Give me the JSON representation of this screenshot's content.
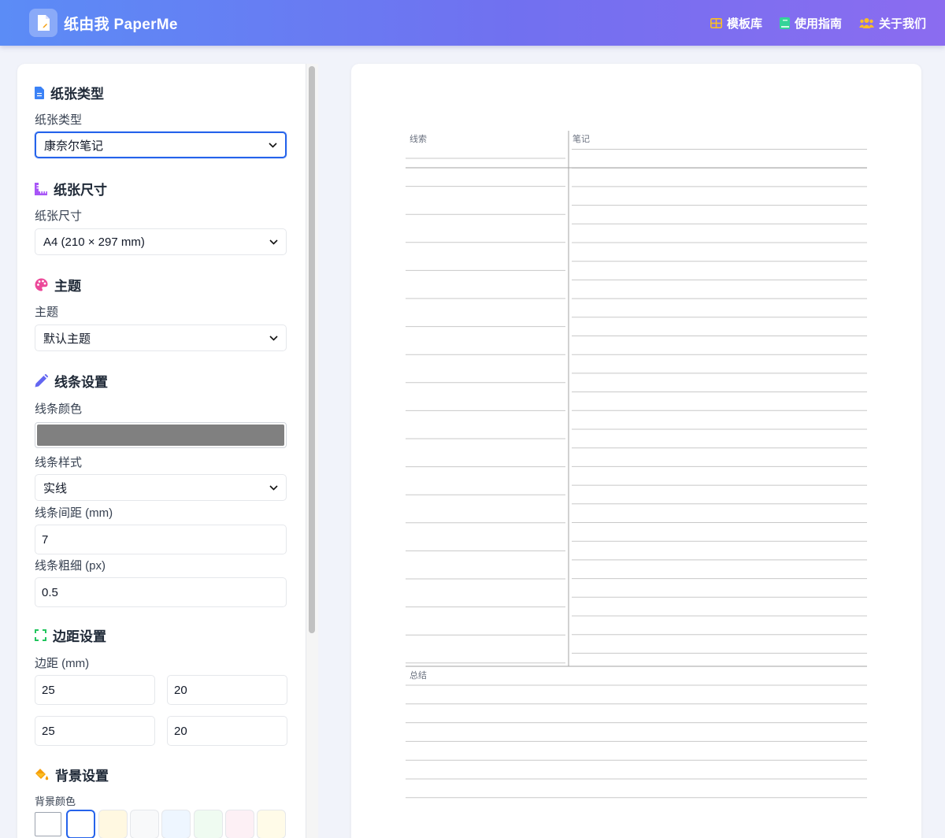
{
  "app": {
    "title": "纸由我 PaperMe",
    "logo_icon": "document-icon"
  },
  "nav": [
    {
      "label": "模板库",
      "icon": "grid-icon",
      "color": "#fbbf24"
    },
    {
      "label": "使用指南",
      "icon": "book-icon",
      "color": "#34d399"
    },
    {
      "label": "关于我们",
      "icon": "users-icon",
      "color": "#fbbf24"
    }
  ],
  "sidebar": {
    "paper_type": {
      "title": "纸张类型",
      "icon": "file-icon",
      "icon_color": "#3b82f6",
      "label": "纸张类型",
      "value": "康奈尔笔记"
    },
    "paper_size": {
      "title": "纸张尺寸",
      "icon": "ruler-icon",
      "icon_color": "#a855f7",
      "label": "纸张尺寸",
      "value": "A4 (210 × 297 mm)"
    },
    "theme": {
      "title": "主题",
      "icon": "palette-icon",
      "icon_color": "#ec4899",
      "label": "主题",
      "value": "默认主题"
    },
    "lines": {
      "title": "线条设置",
      "icon": "pencil-icon",
      "icon_color": "#6366f1",
      "color_label": "线条颜色",
      "color_value": "#808080",
      "style_label": "线条样式",
      "style_value": "实线",
      "spacing_label": "线条间距 (mm)",
      "spacing_value": "7",
      "width_label": "线条粗细 (px)",
      "width_value": "0.5"
    },
    "margins": {
      "title": "边距设置",
      "icon": "expand-icon",
      "icon_color": "#22c55e",
      "label": "边距 (mm)",
      "values": [
        "25",
        "20",
        "25",
        "20"
      ]
    },
    "background": {
      "title": "背景设置",
      "icon": "paint-bucket-icon",
      "icon_color": "#f59e0b",
      "label": "背景颜色",
      "swatches": [
        "#ffffff",
        "#ffffff",
        "#fff8e1",
        "#f8f9fa",
        "#eef6ff",
        "#effbf1",
        "#fdf0f5",
        "#fffbe8"
      ],
      "selected_index": 1
    }
  },
  "paper": {
    "cue_label": "线索",
    "notes_label": "笔记",
    "summary_label": "总结",
    "line_color": "#c8c8c8",
    "line_style": "solid",
    "line_spacing_mm": 7
  }
}
